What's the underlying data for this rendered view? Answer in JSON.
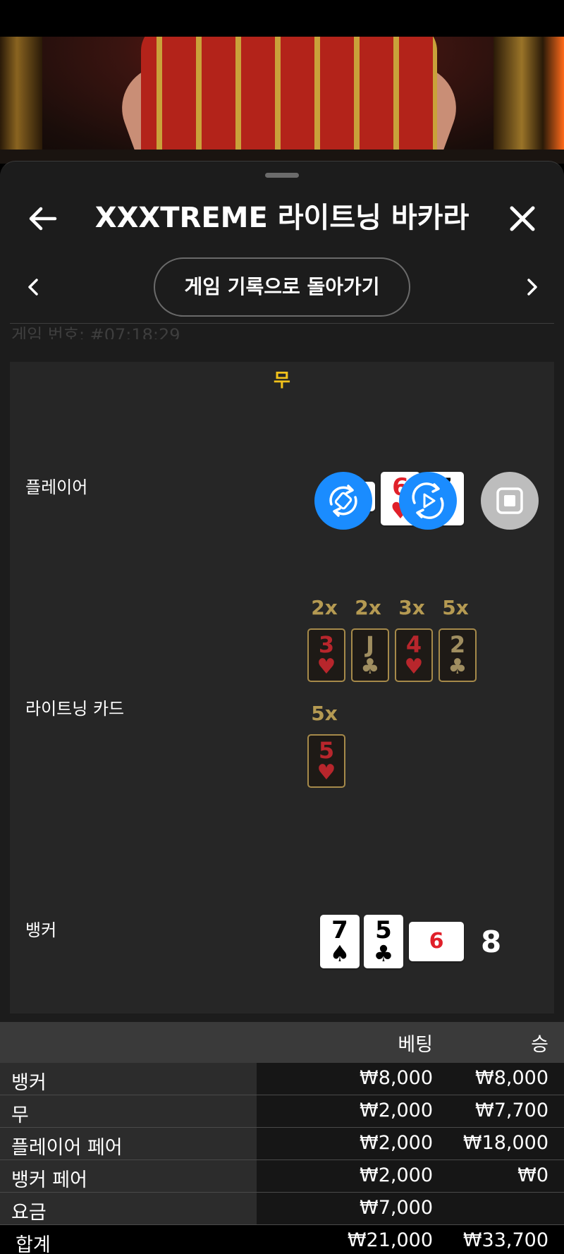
{
  "header": {
    "title": "XXXTREME 라이트닝 바카라"
  },
  "nav": {
    "back_to_history": "게임 기록으로 돌아가기"
  },
  "game_number": "게임 번호: #07:18:29",
  "result": {
    "outcome": "무",
    "player": {
      "label": "플레이어",
      "cards": [
        {
          "rank": "",
          "suit": ""
        },
        {
          "rank": "6",
          "suit": "♥"
        },
        {
          "rank": "7",
          "suit": ""
        }
      ]
    },
    "lightning": {
      "label": "라이트닝 카드",
      "cards": [
        {
          "mult": "2x",
          "rank": "3",
          "suit": "♥",
          "color": "red"
        },
        {
          "mult": "2x",
          "rank": "J",
          "suit": "♣",
          "color": "black"
        },
        {
          "mult": "3x",
          "rank": "4",
          "suit": "♥",
          "color": "red"
        },
        {
          "mult": "5x",
          "rank": "2",
          "suit": "♣",
          "color": "black"
        },
        {
          "mult": "5x",
          "rank": "5",
          "suit": "♥",
          "color": "red"
        }
      ]
    },
    "banker": {
      "label": "뱅커",
      "cards": [
        {
          "rank": "7",
          "suit": "♠"
        },
        {
          "rank": "5",
          "suit": "♣"
        },
        {
          "rank": "6",
          "suit": "♥"
        }
      ],
      "score": "8"
    }
  },
  "bets": {
    "headers": {
      "bet": "베팅",
      "win": "승"
    },
    "rows": [
      {
        "name": "뱅커",
        "bet": "₩8,000",
        "win": "₩8,000"
      },
      {
        "name": "무",
        "bet": "₩2,000",
        "win": "₩7,700"
      },
      {
        "name": "플레이어 페어",
        "bet": "₩2,000",
        "win": "₩18,000"
      },
      {
        "name": "뱅커 페어",
        "bet": "₩2,000",
        "win": "₩0"
      },
      {
        "name": "요금",
        "bet": "₩7,000",
        "win": ""
      }
    ],
    "total": {
      "name": "합계",
      "bet": "₩21,000",
      "win": "₩33,700"
    }
  },
  "colors": {
    "accent_yellow": "#f2c21b",
    "fab_blue": "#1a8cff",
    "lightning_gold": "#b59a52"
  },
  "icons": [
    "back-arrow-icon",
    "close-icon",
    "chevron-left-icon",
    "chevron-right-icon",
    "rotate-icon",
    "replay-icon",
    "stop-icon"
  ]
}
